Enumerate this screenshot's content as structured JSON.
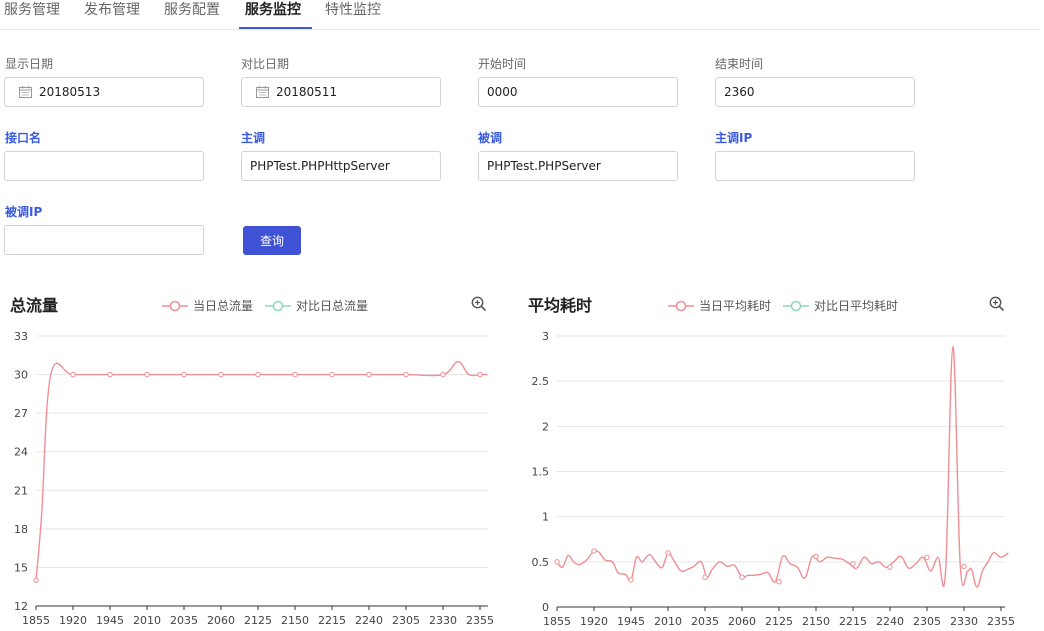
{
  "tabs": [
    {
      "label": "服务管理"
    },
    {
      "label": "发布管理"
    },
    {
      "label": "服务配置"
    },
    {
      "label": "服务监控",
      "active": true
    },
    {
      "label": "特性监控"
    }
  ],
  "form": {
    "show_date": {
      "label": "显示日期",
      "value": "20180513"
    },
    "compare_date": {
      "label": "对比日期",
      "value": "20180511"
    },
    "start_time": {
      "label": "开始时间",
      "value": "0000"
    },
    "end_time": {
      "label": "结束时间",
      "value": "2360"
    },
    "interface_name": {
      "label": "接口名",
      "value": ""
    },
    "caller": {
      "label": "主调",
      "value": "PHPTest.PHPHttpServer"
    },
    "callee": {
      "label": "被调",
      "value": "PHPTest.PHPServer"
    },
    "caller_ip": {
      "label": "主调IP",
      "value": ""
    },
    "callee_ip": {
      "label": "被调IP",
      "value": ""
    },
    "query_label": "查询"
  },
  "colors": {
    "accent": "#3f51d4",
    "series_today": "#f08e96",
    "series_compare": "#8fd6b8"
  },
  "icons": {
    "date": "calendar-icon",
    "zoom": "zoom-in-icon"
  },
  "chart_data": [
    {
      "type": "line",
      "title": "总流量",
      "legend": [
        "当日总流量",
        "对比日总流量"
      ],
      "x_ticks": [
        "1855",
        "1920",
        "1945",
        "2010",
        "2035",
        "2060",
        "2125",
        "2150",
        "2215",
        "2240",
        "2305",
        "2330",
        "2355"
      ],
      "ylim": [
        12,
        33
      ],
      "y_ticks": [
        12,
        15,
        18,
        21,
        24,
        27,
        30,
        33
      ],
      "series": [
        {
          "name": "当日总流量",
          "x": [
            0,
            0.15,
            0.4,
            1,
            2,
            3,
            4,
            5,
            6,
            7,
            8,
            9,
            10,
            11,
            11.4,
            11.7,
            12,
            12.2
          ],
          "y": [
            14,
            19,
            30,
            30,
            30,
            30,
            30,
            30,
            30,
            30,
            30,
            30,
            30,
            30,
            31,
            30,
            30,
            30
          ],
          "markers": [
            0,
            1,
            2,
            3,
            4,
            5,
            6,
            7,
            8,
            9,
            10,
            11,
            12
          ]
        },
        {
          "name": "对比日总流量",
          "x": [],
          "y": []
        }
      ]
    },
    {
      "type": "line",
      "title": "平均耗时",
      "legend": [
        "当日平均耗时",
        "对比日平均耗时"
      ],
      "x_ticks": [
        "1855",
        "1920",
        "1945",
        "2010",
        "2035",
        "2060",
        "2125",
        "2150",
        "2215",
        "2240",
        "2305",
        "2330",
        "2355"
      ],
      "ylim": [
        0,
        3
      ],
      "y_ticks": [
        "0",
        "0.5",
        "1",
        "1.5",
        "2",
        "2.5",
        "3"
      ],
      "series": [
        {
          "name": "当日平均耗时",
          "x": [
            0,
            0.15,
            0.3,
            0.45,
            0.6,
            0.8,
            1,
            1.15,
            1.3,
            1.5,
            1.65,
            1.85,
            2,
            2.15,
            2.3,
            2.5,
            2.7,
            2.85,
            3,
            3.15,
            3.35,
            3.55,
            3.7,
            3.9,
            4.05,
            4.2,
            4.4,
            4.6,
            4.8,
            5,
            5.15,
            5.3,
            5.5,
            5.7,
            5.9,
            6.1,
            6.3,
            6.5,
            6.7,
            6.9,
            7.1,
            7.3,
            7.5,
            7.7,
            7.9,
            8.1,
            8.3,
            8.5,
            8.7,
            8.9,
            9.1,
            9.3,
            9.5,
            9.7,
            9.9,
            10.1,
            10.3,
            10.5,
            10.7,
            10.9,
            11.1,
            11.2,
            11.35,
            11.5,
            11.65,
            11.8,
            12,
            12.2
          ],
          "y": [
            0.5,
            0.44,
            0.57,
            0.5,
            0.47,
            0.52,
            0.62,
            0.6,
            0.52,
            0.5,
            0.38,
            0.36,
            0.3,
            0.55,
            0.5,
            0.58,
            0.48,
            0.44,
            0.6,
            0.52,
            0.4,
            0.42,
            0.45,
            0.5,
            0.33,
            0.42,
            0.5,
            0.45,
            0.46,
            0.33,
            0.35,
            0.35,
            0.36,
            0.38,
            0.28,
            0.56,
            0.48,
            0.44,
            0.32,
            0.56,
            0.5,
            0.55,
            0.54,
            0.53,
            0.48,
            0.43,
            0.55,
            0.48,
            0.5,
            0.44,
            0.5,
            0.56,
            0.43,
            0.48,
            0.55,
            0.4,
            0.55,
            0.38,
            2.88,
            0.45,
            0.4,
            0.42,
            0.22,
            0.4,
            0.5,
            0.6,
            0.55,
            0.6
          ],
          "markers": [
            0,
            1,
            2,
            3,
            4,
            5,
            6,
            7,
            8,
            9,
            10,
            11
          ]
        },
        {
          "name": "对比日平均耗时",
          "x": [],
          "y": []
        }
      ]
    }
  ]
}
